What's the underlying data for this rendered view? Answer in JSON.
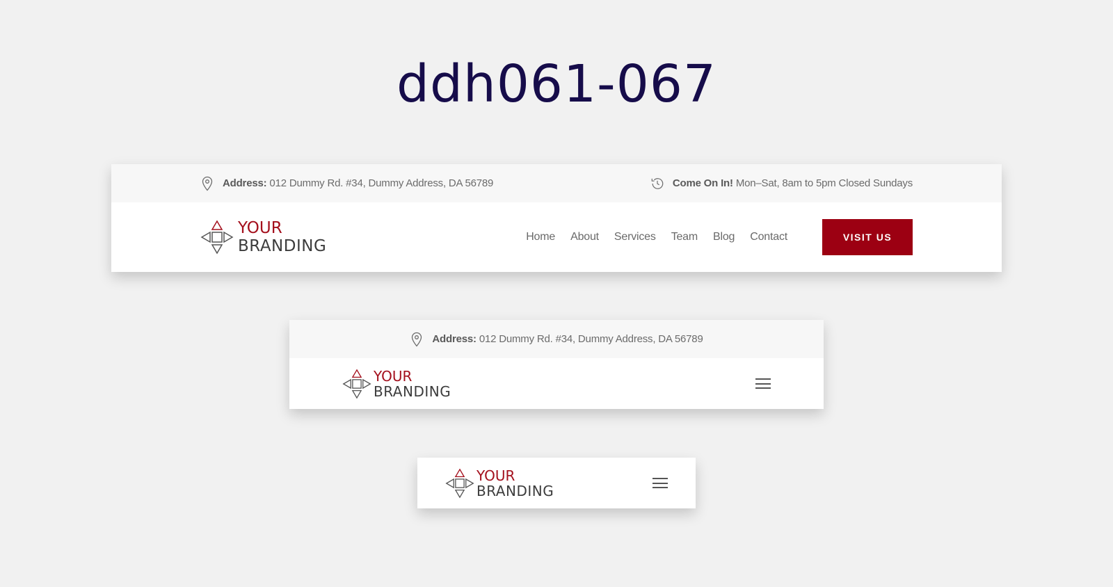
{
  "page": {
    "title": "ddh061-067"
  },
  "colors": {
    "brand_red": "#9c0012",
    "title_navy": "#160c4a",
    "background": "#f1f1f1"
  },
  "topbar": {
    "address_label": "Address:",
    "address_text": "012 Dummy Rd. #34, Dummy Address, DA 56789",
    "address_icon": "map-pin-icon",
    "hours_label": "Come On In!",
    "hours_text": "Mon–Sat, 8am to 5pm Closed Sundays",
    "hours_icon": "history-clock-icon"
  },
  "logo": {
    "line1": "YOUR",
    "line2": "BRANDING",
    "icon": "diamond-arrows-logo-icon"
  },
  "nav": {
    "items": [
      "Home",
      "About",
      "Services",
      "Team",
      "Blog",
      "Contact"
    ]
  },
  "cta": {
    "label": "VISIT US"
  },
  "menu": {
    "icon": "hamburger-menu-icon"
  }
}
